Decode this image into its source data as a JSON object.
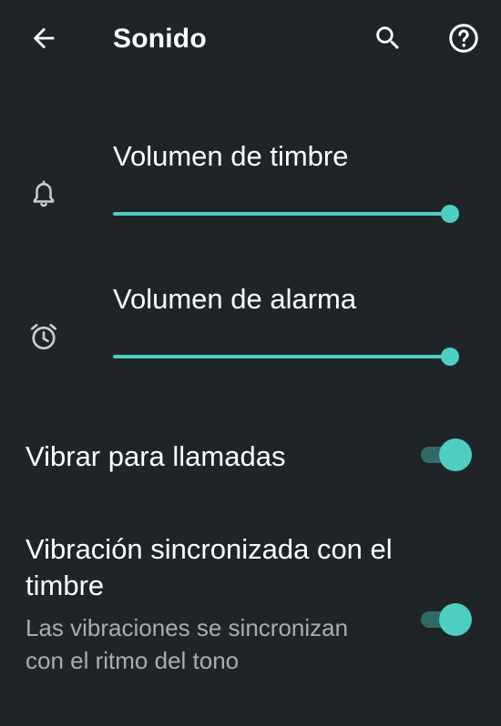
{
  "toolbar": {
    "title": "Sonido",
    "back_icon": "arrow-left-icon",
    "search_icon": "search-icon",
    "help_icon": "help-circle-icon"
  },
  "sliders": [
    {
      "label": "Volumen de timbre",
      "icon": "bell-icon",
      "value_fraction": 1.0
    },
    {
      "label": "Volumen de alarma",
      "icon": "alarm-clock-icon",
      "value_fraction": 1.0
    }
  ],
  "toggles": [
    {
      "title": "Vibrar para llamadas",
      "summary": "",
      "checked": true
    },
    {
      "title": "Vibración sincronizada con el timbre",
      "summary": "Las vibraciones se sincronizan con el ritmo del tono",
      "checked": true
    }
  ],
  "colors": {
    "background": "#1f2429",
    "accent": "#4ecdc1",
    "switch_track": "#2f6a66",
    "text_primary": "#ffffff",
    "text_secondary": "#a8adb2"
  }
}
